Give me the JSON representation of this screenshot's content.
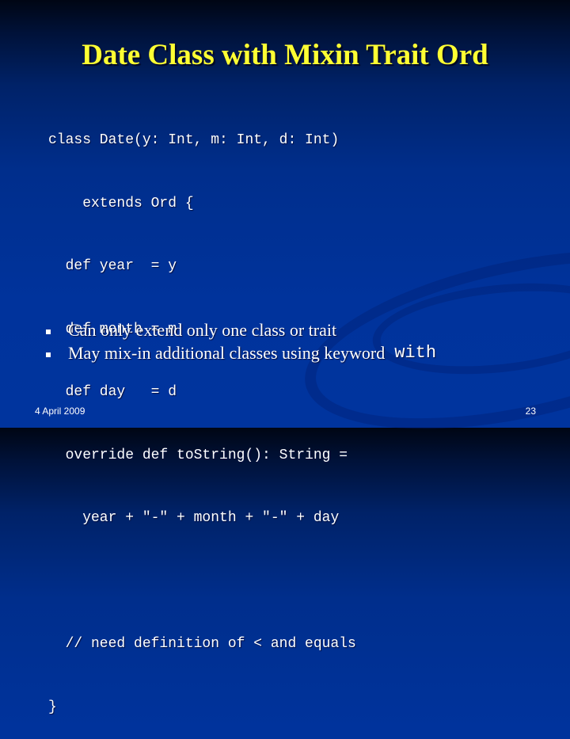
{
  "slide": {
    "title": "Date Class with Mixin Trait Ord",
    "code_lines": [
      "class Date(y: Int, m: Int, d: Int)",
      "    extends Ord {",
      "  def year  = y",
      "  def month = m",
      "  def day   = d",
      "  override def toString(): String =",
      "    year + \"-\" + month + \"-\" + day",
      "",
      "  // need definition of < and equals",
      "}"
    ],
    "bullets": [
      {
        "text": "Can only extend only one class or trait",
        "keyword": ""
      },
      {
        "text": "May mix-in additional classes using keyword",
        "keyword": "with"
      }
    ],
    "footer": {
      "date": "4 April 2009",
      "page_number": "23"
    },
    "colors": {
      "title": "#ffff33",
      "text": "#ffffff",
      "background": "#00339c"
    }
  }
}
